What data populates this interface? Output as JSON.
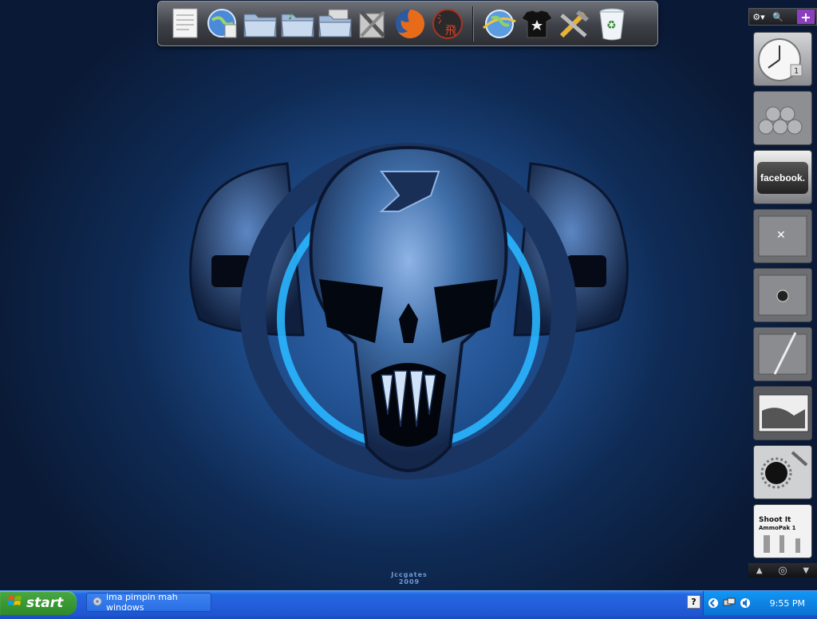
{
  "wallpaper": {
    "signature": "Jccgates 2009",
    "accent_color": "#29b6ff"
  },
  "dock": {
    "items": [
      {
        "icon": "text-document-icon"
      },
      {
        "icon": "network-globe-icon"
      },
      {
        "icon": "folder-icon"
      },
      {
        "icon": "music-folder-icon"
      },
      {
        "icon": "pictures-folder-icon"
      },
      {
        "icon": "tools-icon"
      },
      {
        "icon": "firefox-icon"
      },
      {
        "icon": "chinese-seal-icon"
      },
      {
        "icon": "internet-explorer-icon"
      },
      {
        "icon": "tshirt-icon"
      },
      {
        "icon": "hammer-wrench-icon"
      },
      {
        "icon": "recycle-bin-icon"
      }
    ]
  },
  "sidebar": {
    "top": {
      "settings": "⚙▾",
      "search": "🔍",
      "add": "+"
    },
    "gadgets": [
      {
        "name": "clock-gadget",
        "value": "1"
      },
      {
        "name": "pool-balls-gadget"
      },
      {
        "name": "facebook-gadget",
        "label": "facebook."
      },
      {
        "name": "butterfly-gadget"
      },
      {
        "name": "webcam-gadget"
      },
      {
        "name": "pen-gadget"
      },
      {
        "name": "photo-gadget"
      },
      {
        "name": "bullet-hole-gadget"
      },
      {
        "name": "shoot-it-gadget",
        "label": "Shoot It",
        "sublabel": "AmmoPak 1"
      }
    ],
    "bottom": {
      "prev": "▲",
      "home": "◎",
      "next": "▼"
    }
  },
  "taskbar": {
    "start_label": "start",
    "windows": [
      {
        "label": "ima pimpin mah windows"
      }
    ],
    "tray": {
      "help": "?",
      "clock": "9:55 PM"
    }
  }
}
